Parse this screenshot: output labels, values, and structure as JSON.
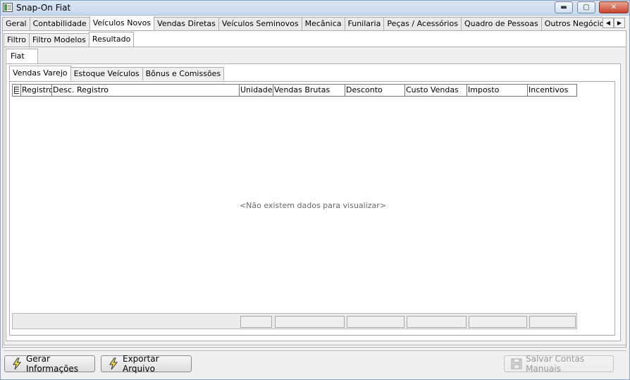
{
  "window": {
    "title": "Snap-On Fiat",
    "minimize": "▬",
    "maximize": "▢",
    "close": "✕"
  },
  "main_tabs": [
    {
      "label": "Geral"
    },
    {
      "label": "Contabilidade"
    },
    {
      "label": "Veículos Novos",
      "active": true
    },
    {
      "label": "Vendas Diretas"
    },
    {
      "label": "Veículos Seminovos"
    },
    {
      "label": "Mecânica"
    },
    {
      "label": "Funilaria"
    },
    {
      "label": "Peças / Acessórios"
    },
    {
      "label": "Quadro de Pessoas"
    },
    {
      "label": "Outros Negócios e Outras Mar"
    }
  ],
  "tab_scroll": {
    "left": "◀",
    "right": "▶"
  },
  "sub_tabs": [
    {
      "label": "Filtro"
    },
    {
      "label": "Filtro Modelos"
    },
    {
      "label": "Resultado",
      "active": true
    }
  ],
  "brand_tabs": [
    {
      "label": "Fiat",
      "active": true
    }
  ],
  "report_tabs": [
    {
      "label": "Vendas Varejo",
      "active": true
    },
    {
      "label": "Estoque Veículos"
    },
    {
      "label": "Bônus e Comissões"
    }
  ],
  "grid": {
    "columns": [
      "Registro",
      "Desc. Registro",
      "Unidades",
      "Vendas Brutas",
      "Desconto",
      "Custo Vendas",
      "Imposto",
      "Incentivos"
    ],
    "empty_message": "<Não existem dados para visualizar>",
    "rows": []
  },
  "buttons": {
    "generate": "Gerar Informações",
    "export": "Exportar Arquivo",
    "save_manual": "Salvar Contas Manuais"
  },
  "icons": {
    "generate": "lightning-icon",
    "export": "lightning-icon",
    "save_manual": "floppy-disk-icon"
  }
}
